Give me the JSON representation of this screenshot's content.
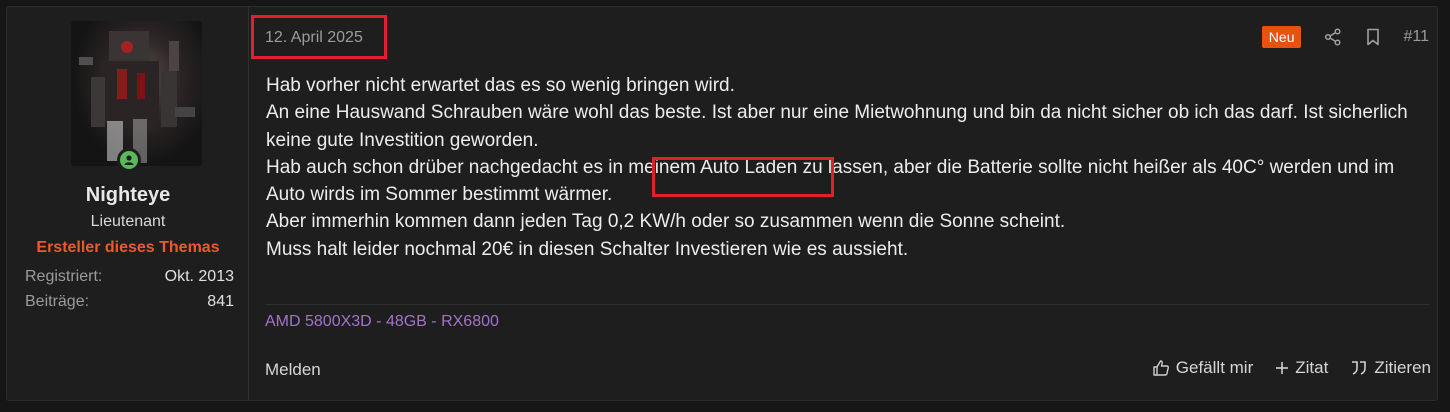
{
  "post": {
    "date": "12. April 2025",
    "badge_new": "Neu",
    "post_number": "#11",
    "icons": {
      "share": "share-icon",
      "bookmark": "bookmark-icon"
    },
    "content": [
      "Hab vorher nicht erwartet das es so wenig bringen wird.",
      "An eine Hauswand Schrauben wäre wohl das beste. Ist aber nur eine Mietwohnung und bin da nicht sicher ob ich das darf. Ist sicherlich keine gute Investition geworden.",
      "Hab auch schon drüber nachgedacht es in meinem Auto Laden zu lassen, aber die Batterie sollte nicht heißer als 40C° werden und im Auto wirds im Sommer bestimmt wärmer.",
      "Aber immerhin kommen dann jeden Tag 0,2 KW/h oder so zusammen wenn die Sonne scheint.",
      "Muss halt leider nochmal 20€ in diesen Schalter Investieren wie es aussieht."
    ],
    "signature": "AMD 5800X3D - 48GB - RX6800",
    "footer": {
      "report": "Melden",
      "like": "Gefällt mir",
      "quote_plus": "Zitat",
      "reply_quote": "Zitieren"
    }
  },
  "user": {
    "name": "Nighteye",
    "title": "Lieutenant",
    "starter_label": "Ersteller dieses Themas",
    "stats": [
      {
        "label": "Registriert:",
        "value": "Okt. 2013"
      },
      {
        "label": "Beiträge:",
        "value": "841"
      }
    ],
    "online_status": "online"
  },
  "colors": {
    "background": "#161616",
    "panel": "#1e1e1e",
    "accent_orange": "#ea5a2c",
    "badge_new": "#e8520f",
    "signature_purple": "#a373c9",
    "highlight_red": "#e0202f",
    "online_green": "#5cb85c"
  }
}
